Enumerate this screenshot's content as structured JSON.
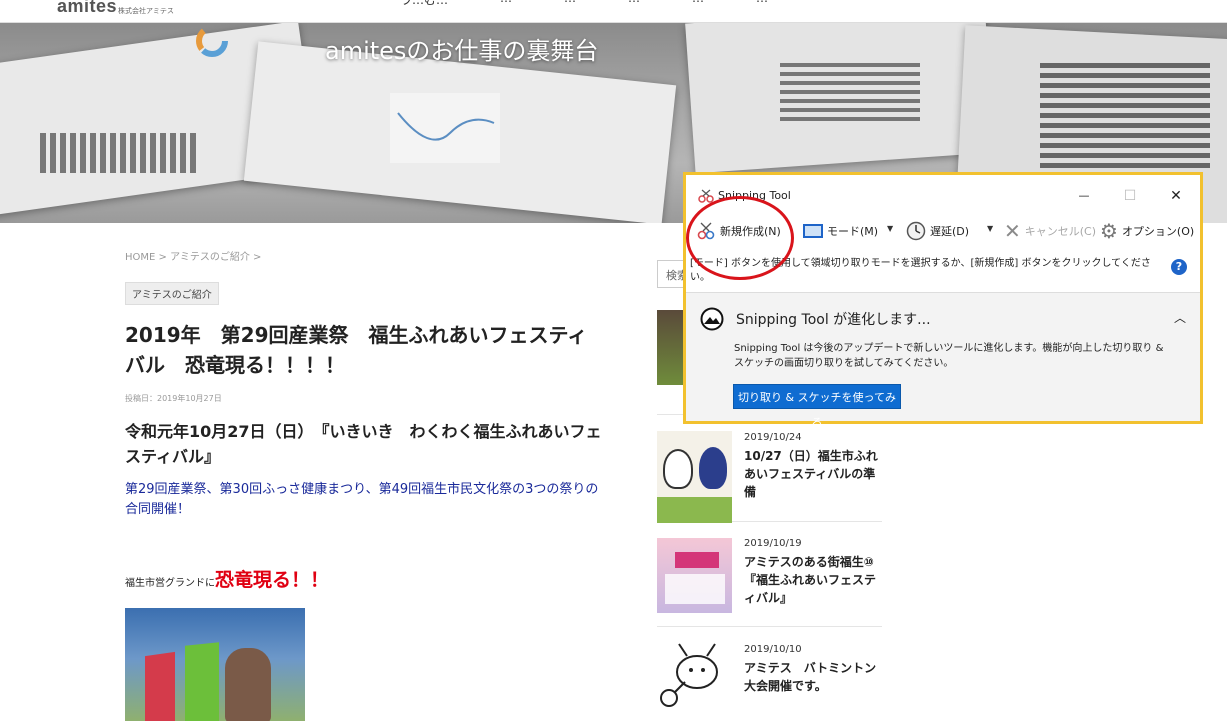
{
  "site": {
    "logo": "amites",
    "logo_sub": "株式会社アミテス",
    "nav": [
      "ラ…む…",
      "…",
      "…",
      "…",
      "…",
      "…"
    ],
    "hero_title": "amitesのお仕事の裏舞台"
  },
  "article": {
    "breadcrumb": "HOME > アミテスのご紹介 >",
    "category": "アミテスのご紹介",
    "title": "2019年　第29回産業祭　福生ふれあいフェスティバル　恐竜現る！！！！",
    "post_date": "投稿日：2019年10月27日",
    "subtitle": "令和元年10月27日（日）　『いきいき　わくわく福生ふれあいフェスティバル』",
    "intro": "第29回産業祭、第30回ふっさ健康まつり、第49回福生市民文化祭の3つの祭りの合同開催！",
    "venue_prefix": "福生市営グランドに",
    "venue_emphasis": "恐竜現る！！"
  },
  "sidebar": {
    "search_tab": "検索",
    "items": [
      {
        "date": "2019/10/24",
        "title": "10/27（日）福生市ふれあいフェスティバルの準備"
      },
      {
        "date": "2019/10/19",
        "title": "アミテスのある街福生⑩　『福生ふれあいフェスティバル』"
      },
      {
        "date": "2019/10/10",
        "title": "アミテス　バトミントン大会開催です。"
      }
    ]
  },
  "snipping_tool": {
    "title": "Snipping Tool",
    "window_buttons": {
      "minimize": "—",
      "maximize": "☐",
      "close": "✕"
    },
    "toolbar": {
      "new": "新規作成(N)",
      "mode": "モード(M)",
      "delay": "遅延(D)",
      "cancel": "キャンセル(C)",
      "options": "オプション(O)"
    },
    "hint": "[モード] ボタンを使用して領域切り取りモードを選択するか、[新規作成] ボタンをクリックしてください。",
    "help": "?",
    "panel": {
      "heading": "Snipping Tool が進化します...",
      "body": "Snipping Tool は今後のアップデートで新しいツールに進化します。機能が向上した切り取り & スケッチの画面切り取りを試してみてください。",
      "button": "切り取り & スケッチを使ってみる"
    }
  },
  "colors": {
    "highlight_frame": "#f2c12e",
    "annotation_circle": "#d9141b",
    "link_blue": "#1a2a9a",
    "emphasis_red": "#e00012",
    "button_blue": "#0f6cd1"
  }
}
